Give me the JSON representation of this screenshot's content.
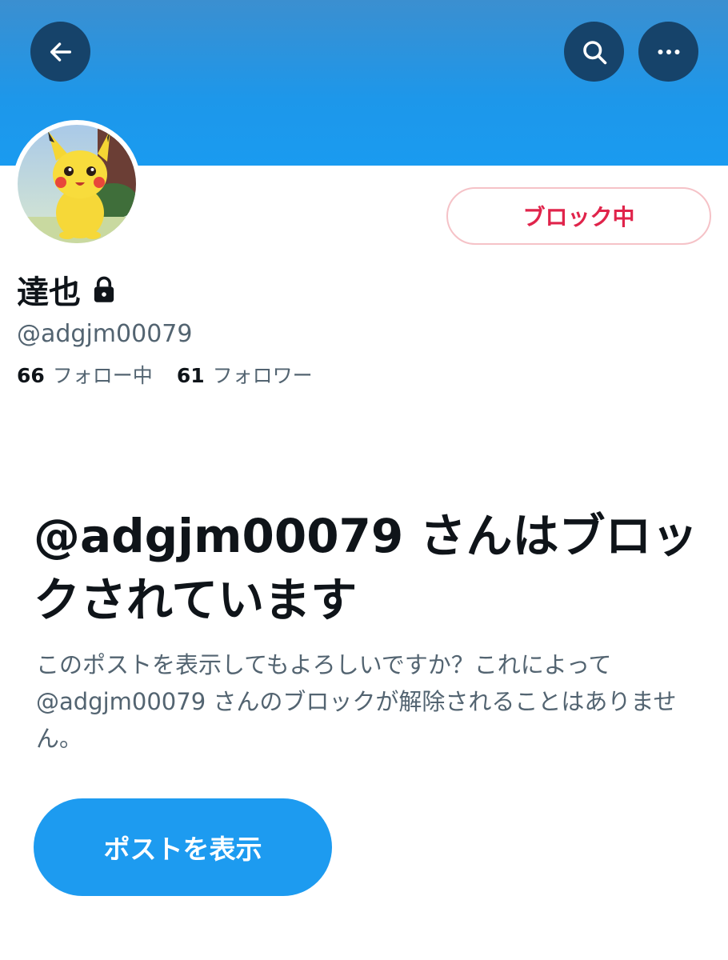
{
  "header": {
    "back_icon": "arrow-left-icon",
    "search_icon": "search-icon",
    "more_icon": "more-horizontal-icon",
    "banner_color": "#1d9bf0"
  },
  "profile": {
    "display_name": "達也",
    "lock_icon": "lock-icon",
    "handle": "@adgjm00079",
    "following_count": "66",
    "following_label": "フォロー中",
    "followers_count": "61",
    "followers_label": "フォロワー",
    "block_button_label": "ブロック中",
    "block_color": "#e0244b"
  },
  "blocked_notice": {
    "title": "@adgjm00079 さんはブロックされています",
    "description": "このポストを表示してもよろしいですか？これによって@adgjm00079 さんのブロックが解除されることはありません。",
    "show_posts_label": "ポストを表示"
  }
}
